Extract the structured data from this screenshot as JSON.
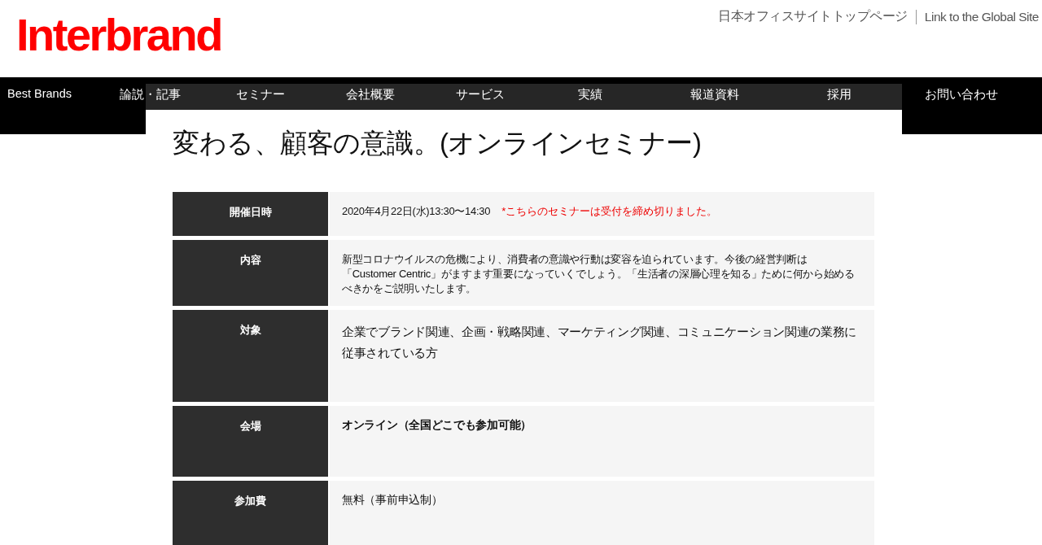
{
  "logo": "Interbrand",
  "top_links": [
    "日本オフィスサイトトップページ",
    "Link to the Global Site"
  ],
  "nav": [
    "Best Brands",
    "論説・記事",
    "セミナー",
    "会社概要",
    "サービス",
    "実績",
    "報道資料",
    "採用",
    "お問い合わせ"
  ],
  "title": "変わる、顧客の意識。(オンラインセミナー)",
  "rows": [
    {
      "label": "開催日時",
      "kind": "small",
      "value": "2020年4月22日(水)13:30〜14:30",
      "note": "*こちらのセミナーは受付を締め切りました。"
    },
    {
      "label": "内容",
      "kind": "small",
      "value": "新型コロナウイルスの危機により、消費者の意識や行動は変容を迫られています。今後の経営判断は「Customer Centric」がますます重要になっていくでしょう。「生活者の深層心理を知る」ために何から始めるべきかをご説明いたします。"
    },
    {
      "label": "対象",
      "kind": "large",
      "value": "企業でブランド関連、企画・戦略関連、マーケティング関連、コミュニケーション関連の業務に従事されている方"
    },
    {
      "label": "会場",
      "kind": "bold",
      "value": "オンライン（全国どこでも参加可能）"
    },
    {
      "label": "参加費",
      "kind": "normal",
      "value": "無料（事前申込制）"
    }
  ]
}
